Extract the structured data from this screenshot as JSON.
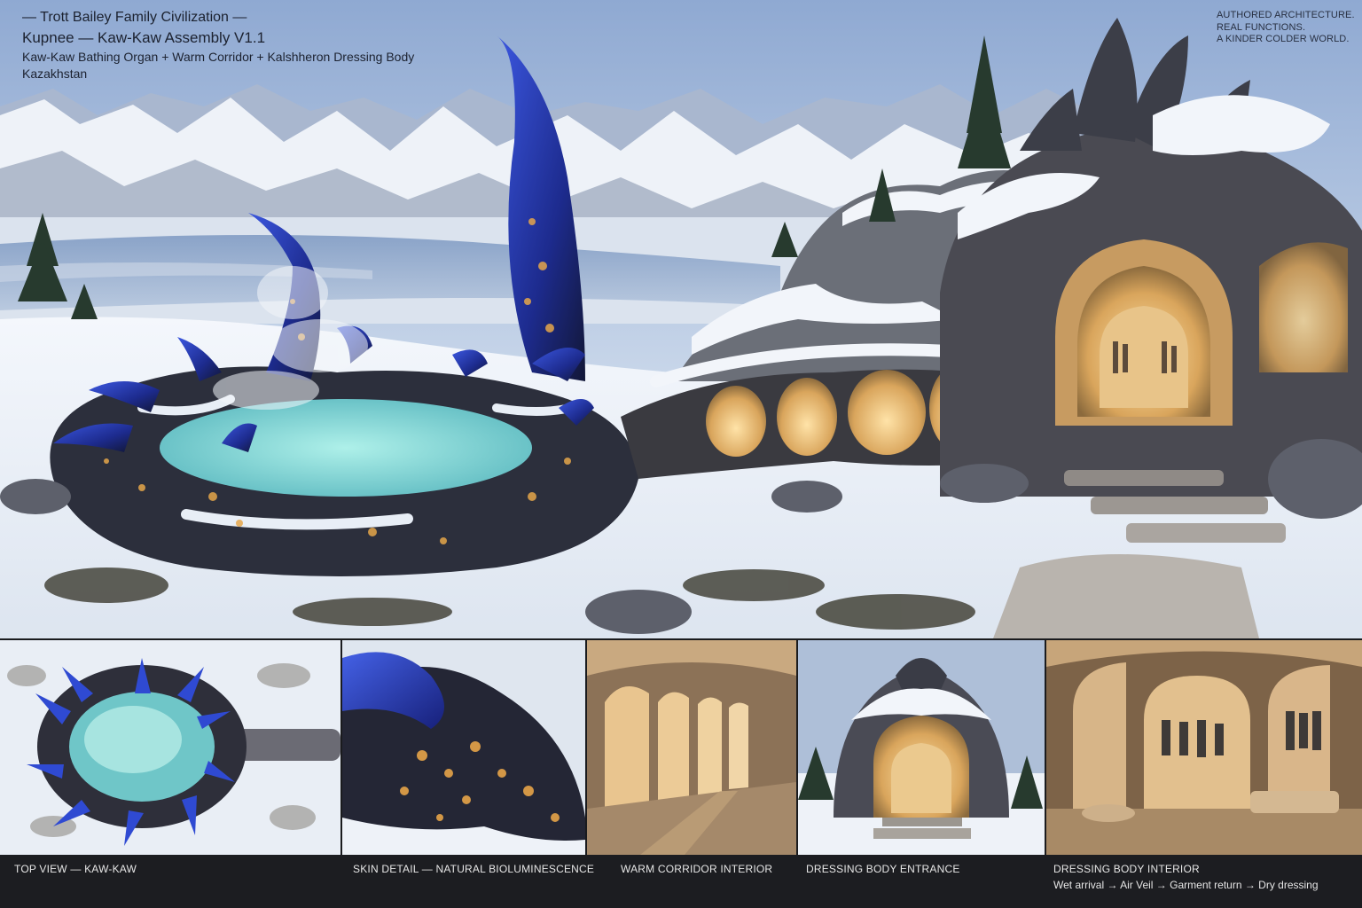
{
  "header": {
    "civilization": "— Trott Bailey Family Civilization —",
    "assembly": "Kupnee — Kaw-Kaw Assembly V1.1",
    "components": "Kaw-Kaw Bathing Organ + Warm Corridor + Kalshheron Dressing Body",
    "location": "Kazakhstan"
  },
  "tagline": {
    "lines": [
      "AUTHORED ARCHITECTURE.",
      "REAL FUNCTIONS.",
      "A KINDER COLDER WORLD."
    ]
  },
  "panels": [
    {
      "caption": "TOP VIEW — KAW-KAW"
    },
    {
      "caption": "SKIN DETAIL — NATURAL BIOLUMINESCENCE"
    },
    {
      "caption": "WARM CORRIDOR INTERIOR"
    },
    {
      "caption": "DRESSING BODY ENTRANCE"
    },
    {
      "caption": "DRESSING BODY INTERIOR",
      "subcaption": "Wet arrival → Air Veil → Garment return → Dry dressing"
    }
  ],
  "colors": {
    "sky_top": "#9db4d6",
    "sky_bottom": "#dfe8f2",
    "snow": "#f2f5fa",
    "shell_dark": "#2a2d3a",
    "horn_blue": "#2a3fc2",
    "warm_glow": "#f1c27a",
    "pool": "#7fd6d3",
    "caption_bar": "#1c1d21"
  }
}
